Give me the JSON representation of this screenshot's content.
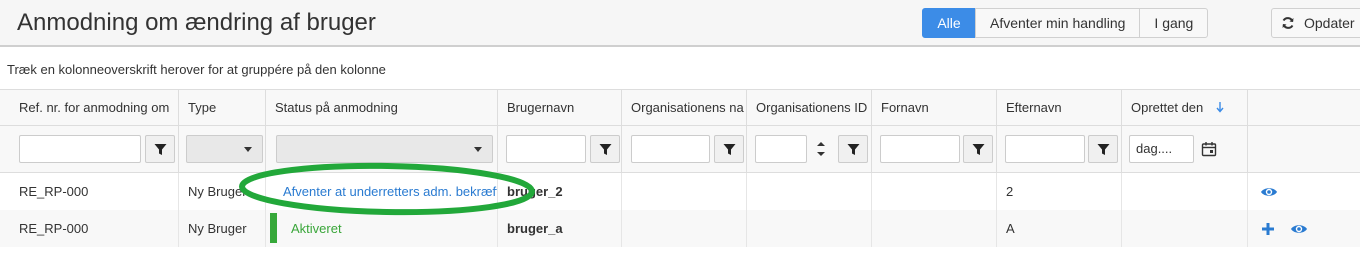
{
  "header": {
    "title": "Anmodning om ændring af bruger",
    "filters": [
      "Alle",
      "Afventer min handling",
      "I gang"
    ],
    "refresh_label": "Opdater"
  },
  "grouping_hint": "Træk en kolonneoverskrift herover for at gruppére på den kolonne",
  "columns": [
    "Ref. nr. for anmodning om",
    "Type",
    "Status på anmodning",
    "Brugernavn",
    "Organisationens na",
    "Organisationens ID",
    "Fornavn",
    "Efternavn",
    "Oprettet den"
  ],
  "date_placeholder": "dag....",
  "rows": [
    {
      "ref": "RE_RP-000",
      "type": "Ny Bruger",
      "status": "Afventer at underretters adm. bekræfte",
      "username": "bruger_2",
      "org_name": "",
      "org_id": "",
      "firstname": "",
      "lastname": "2",
      "created": ""
    },
    {
      "ref": "RE_RP-000",
      "type": "Ny Bruger",
      "status": "Aktiveret",
      "username": "bruger_a",
      "org_name": "",
      "org_id": "",
      "firstname": "",
      "lastname": "A",
      "created": ""
    }
  ],
  "colors": {
    "accent": "#3c8ce7",
    "link": "#2a7bd1",
    "success": "#3aa63a",
    "annotation": "#22a83a"
  },
  "icons": {
    "refresh": "refresh-icon",
    "filter": "filter-icon",
    "sort": "sort-desc-icon",
    "calendar": "calendar-icon",
    "view": "eye-icon",
    "add": "plus-icon"
  }
}
